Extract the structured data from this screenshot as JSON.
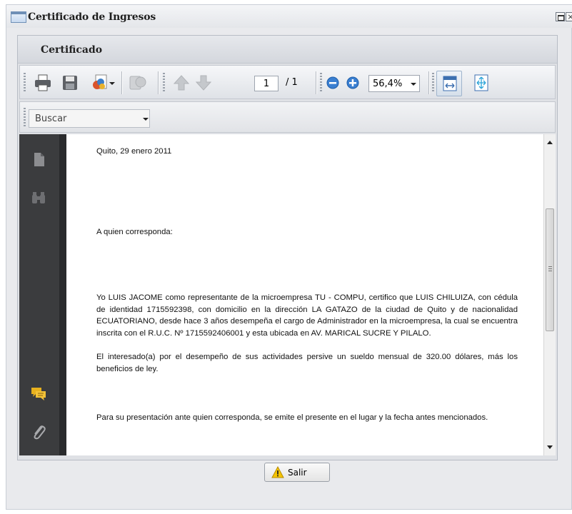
{
  "window": {
    "title": "Certificado de Ingresos",
    "close_glyph": "×"
  },
  "panel": {
    "title": "Certificado"
  },
  "toolbar": {
    "current_page": "1",
    "total_pages": "/ 1",
    "zoom": "56,4%",
    "icons": [
      "print-icon",
      "save-icon",
      "export-icon",
      "share-icon",
      "prev-page-icon",
      "next-page-icon",
      "zoom-out-icon",
      "zoom-in-icon",
      "fit-width-icon",
      "fit-page-icon"
    ]
  },
  "search": {
    "placeholder": "Buscar"
  },
  "document": {
    "date_line": "Quito, 29 enero 2011",
    "salutation": "A quien corresponda:",
    "body_paragraph": "Yo LUIS JACOME como representante de la microempresa TU - COMPU, certifico que LUIS CHILUIZA, con cédula de identidad 1715592398, con domicilio en la dirección LA GATAZO de la ciudad de Quito y de nacionalidad ECUATORIANO, desde hace 3 años desempeña el cargo de Administrador en la microempresa, la cual se encuentra inscrita con el R.U.C. Nº 1715592406001 y esta ubicada en AV. MARICAL SUCRE Y PILALO.",
    "salary_paragraph": "El interesado(a) por el desempeño de sus actividades persive un sueldo mensual de 320.00 dólares, más los beneficios de ley.",
    "closing_paragraph": "Para su presentación ante quien corresponda, se emite el presente en el lugar y la fecha antes mencionados."
  },
  "side_rail": {
    "icons": [
      "pages-icon",
      "binoculars-icon",
      "comments-icon",
      "attachment-icon"
    ]
  },
  "footer": {
    "exit_label": "Salir"
  },
  "colors": {
    "viewer_background": "#2e2f31",
    "window_background": "#e9eaed",
    "warning_icon": "#f5c400"
  }
}
